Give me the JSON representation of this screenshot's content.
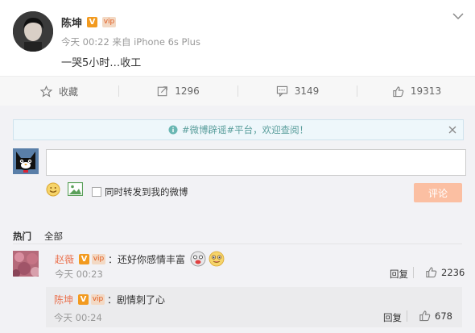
{
  "post": {
    "author": "陈坤",
    "meta": "今天 00:22 来自 iPhone 6s Plus",
    "text": "一哭5小时…收工",
    "badge_v": "V",
    "badge_vip": "vip"
  },
  "actions": {
    "favorite": "收藏",
    "repost_count": "1296",
    "comment_count": "3149",
    "like_count": "19313"
  },
  "notice": {
    "text": "#微博辟谣#平台，欢迎查阅！"
  },
  "composer": {
    "placeholder": "",
    "repost_checkbox_label": "同时转发到我的微博",
    "submit_label": "评论"
  },
  "filter_tabs": [
    "热门",
    "全部"
  ],
  "comments": [
    {
      "author": "赵薇",
      "text": "：还好你感情丰富",
      "time": "今天 00:23",
      "reply_label": "回复",
      "like_count": "2236"
    }
  ],
  "replies": [
    {
      "author": "陈坤",
      "text": "：剧情刺了心",
      "time": "今天 00:24",
      "reply_label": "回复",
      "like_count": "678"
    }
  ],
  "colors": {
    "accent": "#eb7350",
    "button_disabled": "#fbbfa2",
    "notice_text": "#5a9e9c",
    "link": "#eb7350"
  }
}
